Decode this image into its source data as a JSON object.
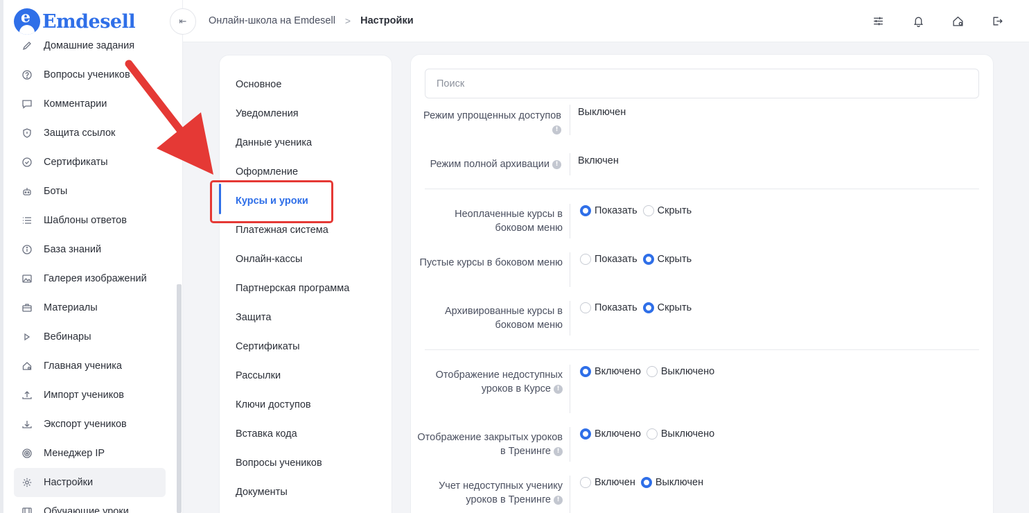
{
  "brand": {
    "name": "Emdesell",
    "logo_letter": "e"
  },
  "sidebar": {
    "items": [
      {
        "label": "Домашние задания",
        "icon": "pencil-icon"
      },
      {
        "label": "Вопросы учеников",
        "icon": "question-circle-icon"
      },
      {
        "label": "Комментарии",
        "icon": "comment-icon"
      },
      {
        "label": "Защита ссылок",
        "icon": "shield-icon"
      },
      {
        "label": "Сертификаты",
        "icon": "badge-check-icon"
      },
      {
        "label": "Боты",
        "icon": "robot-icon"
      },
      {
        "label": "Шаблоны ответов",
        "icon": "list-icon"
      },
      {
        "label": "База знаний",
        "icon": "info-circle-icon"
      },
      {
        "label": "Галерея изображений",
        "icon": "image-icon"
      },
      {
        "label": "Материалы",
        "icon": "briefcase-icon"
      },
      {
        "label": "Вебинары",
        "icon": "play-icon"
      },
      {
        "label": "Главная ученика",
        "icon": "home-icon"
      },
      {
        "label": "Импорт учеников",
        "icon": "upload-icon"
      },
      {
        "label": "Экспорт учеников",
        "icon": "download-icon"
      },
      {
        "label": "Менеджер IP",
        "icon": "target-icon"
      },
      {
        "label": "Настройки",
        "icon": "gear-icon",
        "active": true
      },
      {
        "label": "Обучающие уроки",
        "icon": "film-icon"
      }
    ]
  },
  "header": {
    "collapse_icon": "collapse-left-icon",
    "breadcrumb": {
      "parent": "Онлайн-школа на Emdesell",
      "separator": ">",
      "current": "Настройки"
    },
    "icons": [
      "sliders-icon",
      "bell-icon",
      "home-settings-icon",
      "logout-icon"
    ]
  },
  "settings_menu": {
    "items": [
      "Основное",
      "Уведомления",
      "Данные ученика",
      "Оформление",
      "Курсы и уроки",
      "Платежная система",
      "Онлайн-кассы",
      "Партнерская программа",
      "Защита",
      "Сертификаты",
      "Рассылки",
      "Ключи доступов",
      "Вставка кода",
      "Вопросы учеников",
      "Документы"
    ],
    "active": "Курсы и уроки"
  },
  "content": {
    "search_placeholder": "Поиск",
    "settings": {
      "simplified_access": {
        "label": "Режим упрощенных доступов",
        "value": "Выключен"
      },
      "full_archive": {
        "label": "Режим полной архивации",
        "value": "Включен"
      },
      "unpaid_courses": {
        "label": "Неоплаченные курсы в боковом меню",
        "options": [
          "Показать",
          "Скрыть"
        ],
        "selected": "Показать"
      },
      "empty_courses": {
        "label": "Пустые курсы в боковом меню",
        "options": [
          "Показать",
          "Скрыть"
        ],
        "selected": "Скрыть"
      },
      "archived_courses": {
        "label": "Архивированные курсы в боковом меню",
        "options": [
          "Показать",
          "Скрыть"
        ],
        "selected": "Скрыть"
      },
      "unavailable_lessons": {
        "label": "Отображение недоступных уроков в Курсе",
        "options": [
          "Включено",
          "Выключено"
        ],
        "selected": "Включено"
      },
      "closed_lessons": {
        "label": "Отображение закрытых уроков в Тренинге",
        "options": [
          "Включено",
          "Выключено"
        ],
        "selected": "Включено"
      },
      "count_unavailable": {
        "label": "Учет недоступных ученику уроков в Тренинге",
        "options": [
          "Включен",
          "Выключен"
        ],
        "selected": "Выключен"
      }
    },
    "info_glyph": "!"
  },
  "colors": {
    "accent": "#2f6fe8",
    "annotation": "#e53935",
    "text": "#2b2f38",
    "muted": "#4b5060"
  }
}
